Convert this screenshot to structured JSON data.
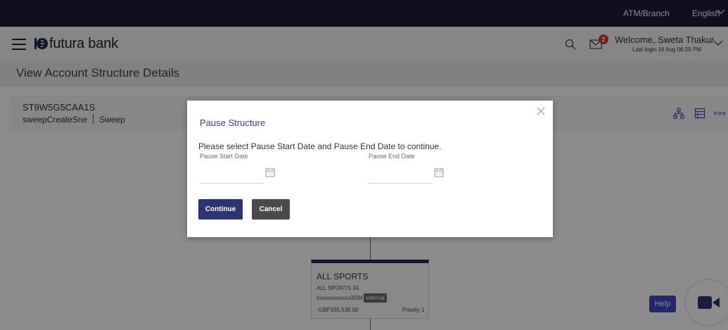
{
  "topbar": {
    "atm_branch": "ATM/Branch",
    "language": "English"
  },
  "header": {
    "brand": "futura bank",
    "notification_count": "2",
    "welcome": "Welcome, Sweta Thakur",
    "last_login": "Last login 16 Aug 06:29 PM"
  },
  "page": {
    "title": "View Account Structure Details"
  },
  "account": {
    "id": "ST9W5G5CAA1S",
    "name": "sweepCreateSne",
    "type": "Sweep"
  },
  "node": {
    "title": "ALL SPORTS",
    "subtitle": "ALL SPORTS 34",
    "account_no": "xxxxxxxxxxxx0034",
    "tag": "Internal",
    "balance": "-GBP335,538.00",
    "priority": "Priority 1"
  },
  "help": {
    "label": "Help"
  },
  "modal": {
    "title": "Pause Structure",
    "instruction": "Please select Pause Start Date and Pause End Date to continue.",
    "start_label": "Pause Start Date",
    "end_label": "Pause End Date",
    "start_value": "",
    "end_value": "",
    "continue_label": "Continue",
    "cancel_label": "Cancel"
  },
  "icons": {
    "brand_color": "#2c3477",
    "accent_color": "#3d4cc4",
    "badge_color": "#d9382f",
    "items": [
      "menu-icon",
      "logo-icon",
      "search-icon",
      "mail-icon",
      "chevron-down-icon",
      "hierarchy-icon",
      "list-view-icon",
      "more-icon",
      "calendar-icon",
      "close-icon",
      "video-icon"
    ]
  }
}
